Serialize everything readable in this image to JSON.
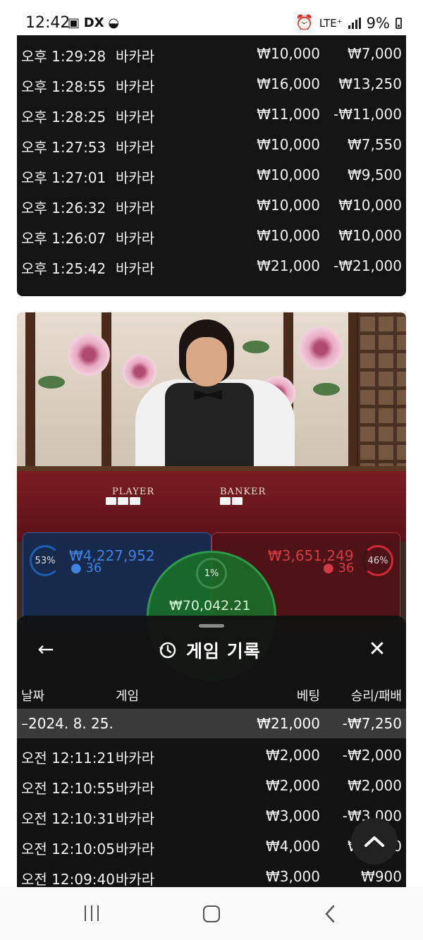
{
  "status_bar": {
    "time": "12:42",
    "network": "LTE⁺",
    "battery": "9%"
  },
  "history_top": {
    "rows": [
      {
        "time": "오후 1:29:28",
        "game": "바카라",
        "bet": "₩10,000",
        "result": "₩7,000"
      },
      {
        "time": "오후 1:28:55",
        "game": "바카라",
        "bet": "₩16,000",
        "result": "₩13,250"
      },
      {
        "time": "오후 1:28:25",
        "game": "바카라",
        "bet": "₩11,000",
        "result": "-₩11,000"
      },
      {
        "time": "오후 1:27:53",
        "game": "바카라",
        "bet": "₩10,000",
        "result": "₩7,550"
      },
      {
        "time": "오후 1:27:01",
        "game": "바카라",
        "bet": "₩10,000",
        "result": "₩9,500"
      },
      {
        "time": "오후 1:26:32",
        "game": "바카라",
        "bet": "₩10,000",
        "result": "₩10,000"
      },
      {
        "time": "오후 1:26:07",
        "game": "바카라",
        "bet": "₩10,000",
        "result": "₩10,000"
      },
      {
        "time": "오후 1:25:42",
        "game": "바카라",
        "bet": "₩21,000",
        "result": "-₩21,000"
      }
    ]
  },
  "table": {
    "player_label": "PLAYER",
    "banker_label": "BANKER"
  },
  "betting": {
    "player": {
      "percent": "53%",
      "amount": "₩4,227,952",
      "people": "36"
    },
    "banker": {
      "percent": "46%",
      "amount": "₩3,651,249",
      "people": "36"
    },
    "tie": {
      "percent": "1%",
      "amount": "₩70,042.21"
    }
  },
  "history_sheet": {
    "title": "게임 기록",
    "headers": {
      "date": "날짜",
      "game": "게임",
      "bet": "베팅",
      "result": "승리/패배"
    },
    "date_row": {
      "date": "–2024. 8. 25.",
      "bet": "₩21,000",
      "result": "-₩7,250"
    },
    "rows": [
      {
        "time": "오전 12:11:21",
        "game": "바카라",
        "bet": "₩2,000",
        "result": "-₩2,000"
      },
      {
        "time": "오전 12:10:55",
        "game": "바카라",
        "bet": "₩2,000",
        "result": "₩2,000"
      },
      {
        "time": "오전 12:10:31",
        "game": "바카라",
        "bet": "₩3,000",
        "result": "-₩3,000"
      },
      {
        "time": "오전 12:10:05",
        "game": "바카라",
        "bet": "₩4,000",
        "result": "₩1,850"
      },
      {
        "time": "오전 12:09:40",
        "game": "바카라",
        "bet": "₩3,000",
        "result": "₩900"
      }
    ]
  }
}
